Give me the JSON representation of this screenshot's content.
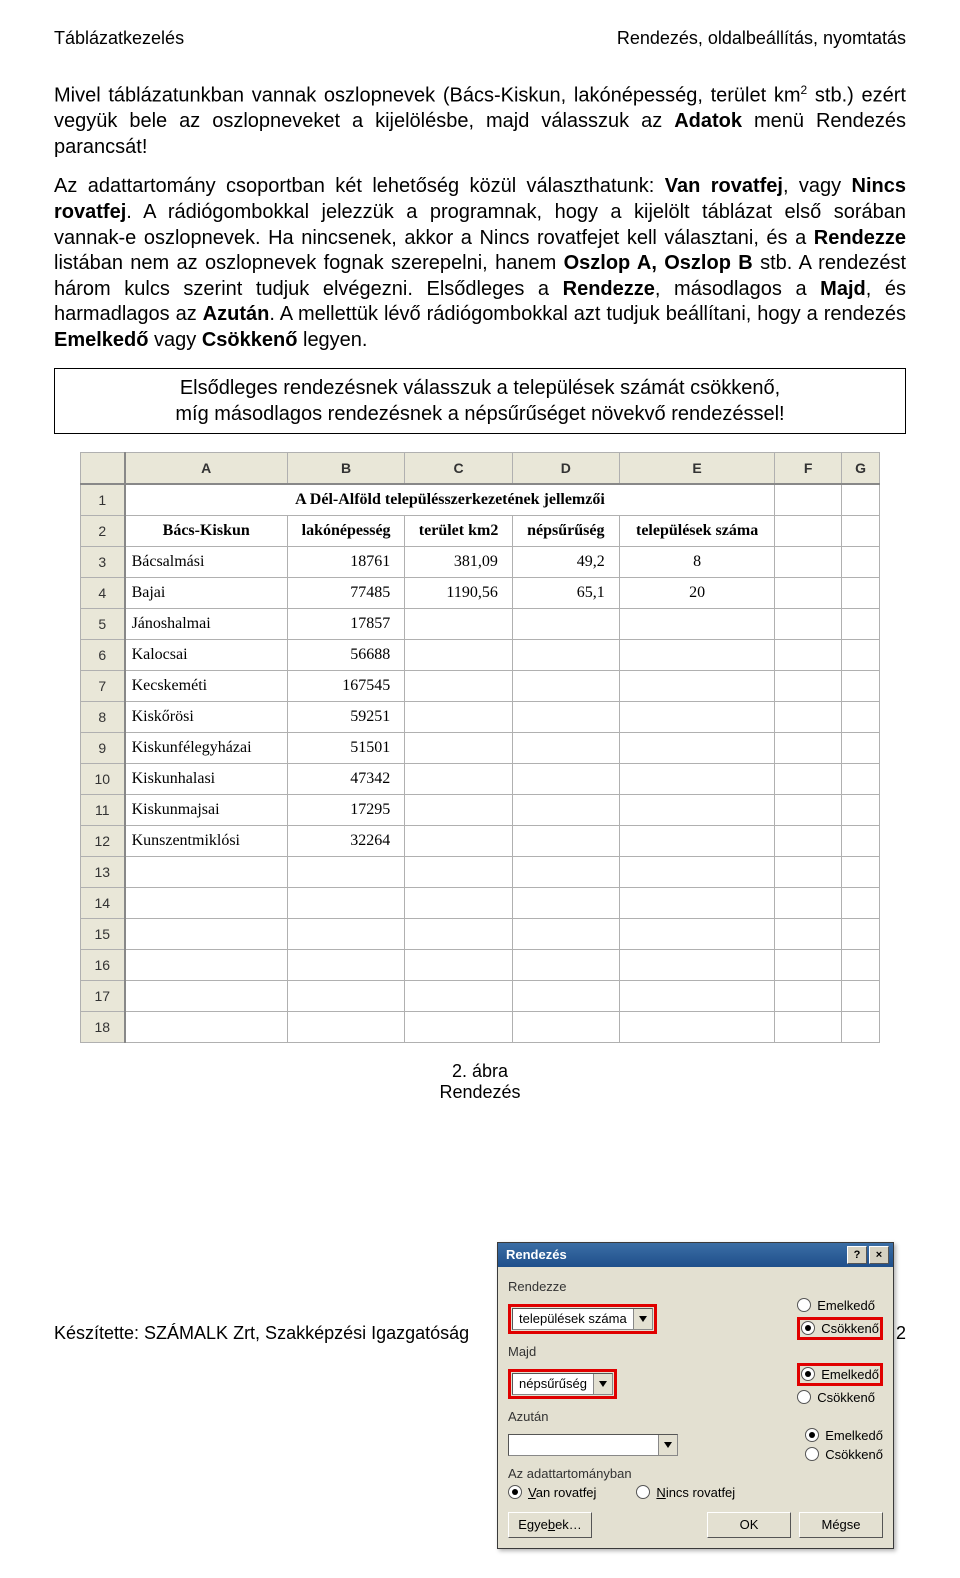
{
  "header": {
    "left": "Táblázatkezelés",
    "right": "Rendezés, oldalbeállítás, nyomtatás"
  },
  "body": {
    "p1a": "Mivel táblázatunkban vannak oszlopnevek (Bács-Kiskun, lakónépesség, terület km",
    "p1sup": "2",
    "p1b": " stb.) ezért vegyük bele az oszlopneveket a kijelölésbe, majd válasszuk az ",
    "p1c": "Adatok",
    "p1d": " menü Rendezés parancsát!",
    "p2a": "Az adattartomány csoportban két lehetőség közül választhatunk: ",
    "p2b": "Van rovatfej",
    "p2c": ", vagy ",
    "p2d": "Nincs rovatfej",
    "p2e": ". A rádiógombokkal jelezzük a programnak, hogy a kijelölt táblázat első sorában vannak-e oszlopnevek. Ha nincsenek, akkor a Nincs rovatfejet kell választani, és a ",
    "p2f": "Rendezze",
    "p2g": " listában nem az oszlopnevek fognak szerepelni, hanem ",
    "p2h": "Oszlop A, Oszlop B",
    "p2i": " stb. A rendezést három kulcs szerint tudjuk elvégezni. Elsődleges a ",
    "p2j": "Rendezze",
    "p2k": ", másodlagos a ",
    "p2l": "Majd",
    "p2m": ", és harmadlagos az ",
    "p2n": "Azután",
    "p2o": ". A mellettük lévő rádiógombokkal azt tudjuk beállítani, hogy a rendezés ",
    "p2p": "Emelkedő",
    "p2q": " vagy ",
    "p2r": "Csökkenő",
    "p2s": " legyen."
  },
  "instruction": {
    "line1": "Elsődleges rendezésnek válasszuk a települések számát csökkenő,",
    "line2": "míg másodlagos rendezésnek a népsűrűséget növekvő rendezéssel!"
  },
  "sheet": {
    "cols": [
      "A",
      "B",
      "C",
      "D",
      "E",
      "F",
      "G"
    ],
    "title": "A Dél-Alföld településszerkezetének jellemzői",
    "headers": [
      "Bács-Kiskun",
      "lakónépesség",
      "terület km2",
      "népsűrűség",
      "települések száma"
    ],
    "rows": [
      {
        "n": "3",
        "name": "Bácsalmási",
        "pop": "18761",
        "area": "381,09",
        "dens": "49,2",
        "cnt": "8"
      },
      {
        "n": "4",
        "name": "Bajai",
        "pop": "77485",
        "area": "1190,56",
        "dens": "65,1",
        "cnt": "20"
      },
      {
        "n": "5",
        "name": "Jánoshalmai",
        "pop": "17857",
        "area": "",
        "dens": "",
        "cnt": ""
      },
      {
        "n": "6",
        "name": "Kalocsai",
        "pop": "56688",
        "area": "",
        "dens": "",
        "cnt": ""
      },
      {
        "n": "7",
        "name": "Kecskeméti",
        "pop": "167545",
        "area": "",
        "dens": "",
        "cnt": ""
      },
      {
        "n": "8",
        "name": "Kiskőrösi",
        "pop": "59251",
        "area": "",
        "dens": "",
        "cnt": ""
      },
      {
        "n": "9",
        "name": "Kiskunfélegyházai",
        "pop": "51501",
        "area": "",
        "dens": "",
        "cnt": ""
      },
      {
        "n": "10",
        "name": "Kiskunhalasi",
        "pop": "47342",
        "area": "",
        "dens": "",
        "cnt": ""
      },
      {
        "n": "11",
        "name": "Kiskunmajsai",
        "pop": "17295",
        "area": "",
        "dens": "",
        "cnt": ""
      },
      {
        "n": "12",
        "name": "Kunszentmiklósi",
        "pop": "32264",
        "area": "",
        "dens": "",
        "cnt": ""
      }
    ],
    "empty_rows": [
      "13",
      "14",
      "15",
      "16",
      "17",
      "18"
    ]
  },
  "dialog": {
    "title": "Rendezés",
    "group1": "Rendezze",
    "dd1": "települések száma",
    "r1a": "Emelkedő",
    "r1b": "Csökkenő",
    "group2": "Majd",
    "dd2": "népsűrűség",
    "r2a": "Emelkedő",
    "r2b": "Csökkenő",
    "group3": "Azután",
    "dd3": "",
    "r3a": "Emelkedő",
    "r3b": "Csökkenő",
    "group4": "Az adattartományban",
    "r4a_pre": "V",
    "r4a": "an rovatfej",
    "r4b_pre": "N",
    "r4b": "incs rovatfej",
    "btn1_pre": "Egye",
    "btn1_u": "b",
    "btn1_post": "ek…",
    "btn2": "OK",
    "btn3": "Mégse"
  },
  "caption": {
    "line1": "2. ábra",
    "line2": "Rendezés"
  },
  "footer": {
    "left": "Készítette: SZÁMALK Zrt, Szakképzési Igazgatóság",
    "right": "2"
  }
}
